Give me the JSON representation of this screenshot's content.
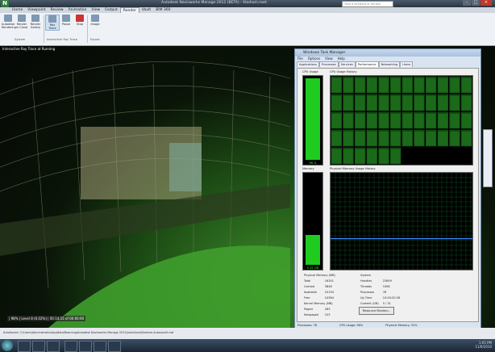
{
  "window": {
    "title": "Autodesk Navisworks Manage 2012 (BETA) - Stadium.nwd",
    "search_placeholder": "Type a keyword or phrase"
  },
  "menu_tabs": [
    "Home",
    "Viewpoint",
    "Review",
    "Animation",
    "View",
    "Output",
    "Render",
    "Vault",
    "BIM 360"
  ],
  "ribbon": {
    "buttons": [
      {
        "label": "Autodesk Rendering"
      },
      {
        "label": "Render in Cloud"
      },
      {
        "label": "Render Gallery"
      },
      {
        "label": "Ray Trace"
      },
      {
        "label": "Pause"
      },
      {
        "label": "Stop"
      },
      {
        "label": "Image"
      }
    ],
    "groups": [
      "System",
      "Interactive Ray Trace",
      "Export"
    ]
  },
  "viewport": {
    "label": "Interactive Ray Trace at Running",
    "progress_text": "| 98% | Level 8 (6.02%) | 00:14:15 of 00:00:00"
  },
  "task_manager": {
    "title": "Windows Task Manager",
    "menu": [
      "File",
      "Options",
      "View",
      "Help"
    ],
    "tabs": [
      "Applications",
      "Processes",
      "Services",
      "Performance",
      "Networking",
      "Users"
    ],
    "active_tab": "Performance",
    "cpu_label": "CPU Usage",
    "cpu_history_label": "CPU Usage History",
    "cpu_value": "96 %",
    "cpu_fraction": 0.96,
    "mem_label": "Memory",
    "mem_history_label": "Physical Memory Usage History",
    "mem_value": "5.32 GB",
    "mem_fraction": 0.32,
    "physical_memory": {
      "header": "Physical Memory (MB)",
      "rows": [
        [
          "Total",
          "16341"
        ],
        [
          "Cached",
          "3848"
        ],
        [
          "Available",
          "10194"
        ],
        [
          "Free",
          "24364"
        ]
      ]
    },
    "kernel_memory": {
      "header": "Kernel Memory (MB)",
      "rows": [
        [
          "Paged",
          "283"
        ],
        [
          "Nonpaged",
          "103"
        ]
      ]
    },
    "system": {
      "header": "System",
      "rows": [
        [
          "Handles",
          "22649"
        ],
        [
          "Threads",
          "1006"
        ],
        [
          "Processes",
          "78"
        ],
        [
          "Up Time",
          "10:00:20:28"
        ],
        [
          "Commit (GB)",
          "5 / 31"
        ]
      ]
    },
    "resource_button": "Resource Monitor...",
    "status": {
      "processes": "Processes: 78",
      "cpu": "CPU Usage: 96%",
      "memory": "Physical Memory: 32%"
    }
  },
  "status_bar": {
    "text": "AutoSaved: C:\\Users\\Administrator\\AppData\\Roaming\\Autodesk Navisworks Manage 2012\\AutoSave\\Stadium.Autosave0.nwf"
  },
  "taskbar": {
    "time": "1:05 PM",
    "date": "11/9/2010"
  }
}
